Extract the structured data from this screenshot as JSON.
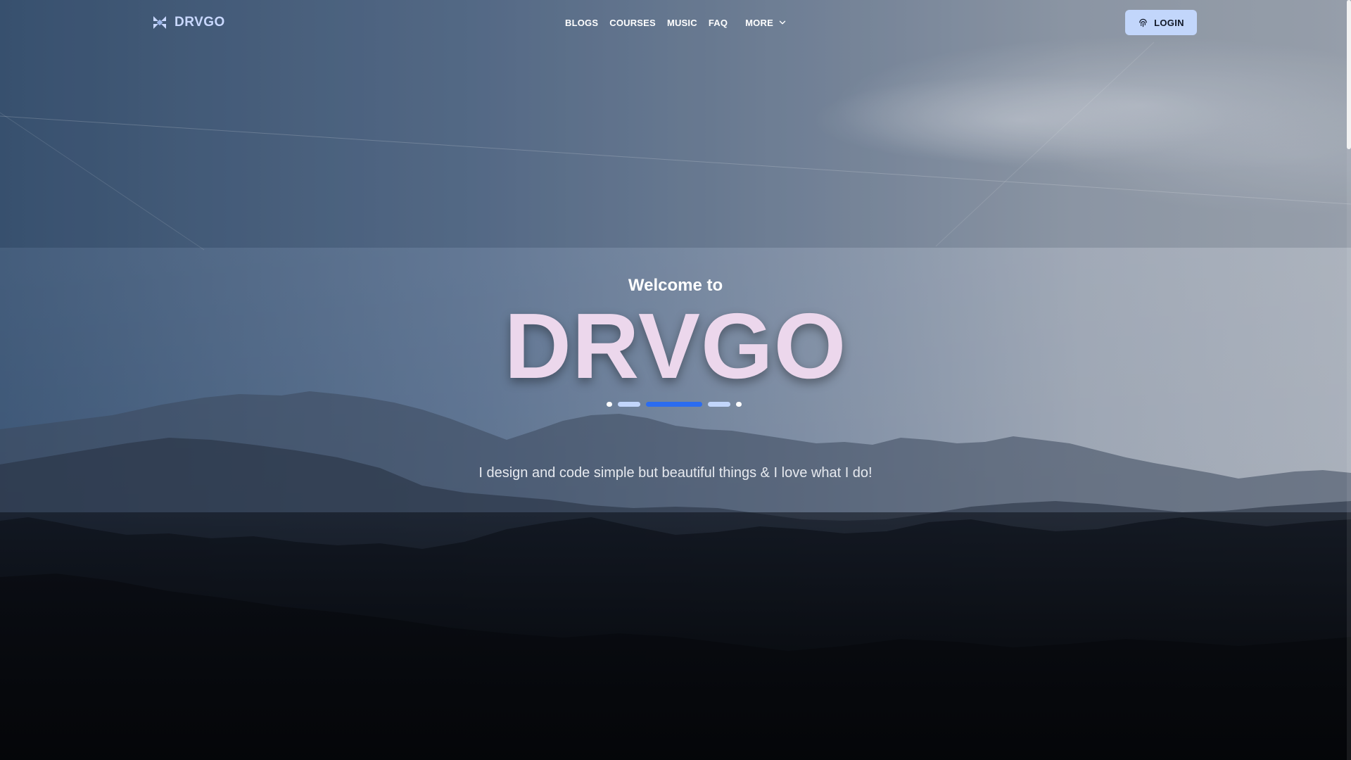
{
  "brand": {
    "name": "DRVGO",
    "logo_icon": "drvgo-logo-icon"
  },
  "nav": {
    "links": [
      "BLOGS",
      "COURSES",
      "MUSIC",
      "FAQ"
    ],
    "more_label": "MORE",
    "more_icon": "chevron-down-icon"
  },
  "login": {
    "label": "LOGIN",
    "icon": "fingerprint-icon"
  },
  "hero": {
    "welcome": "Welcome to",
    "title": "DRVGO",
    "subtitle": "I design and code simple but beautiful things & I love what I do!"
  },
  "colors": {
    "accent_blue": "#2b6cf0",
    "light_blue": "#c2d6fb",
    "title_pink": "#ecd7ec",
    "brand_text": "#c9d8ff"
  }
}
